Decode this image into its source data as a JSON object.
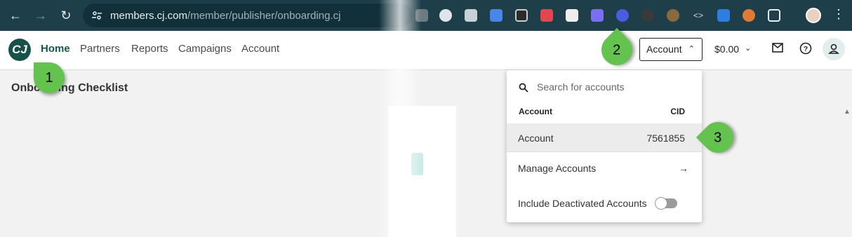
{
  "browser": {
    "url_host": "members.cj.com",
    "url_path": "/member/publisher/onboarding.cj",
    "extensions": [
      "bookmark-ext",
      "pinwheel-ext",
      "text-ext",
      "translate-ext",
      "layers-ext",
      "red-ext",
      "pen-ext",
      "gear-ext",
      "glasses-ext",
      "fire-ext",
      "face-ext",
      "code-ext",
      "tag-ext",
      "cookie-ext"
    ],
    "colors": {
      "chrome": "#1e3f4a",
      "omnibox": "#12303a"
    }
  },
  "header": {
    "logo_text": "CJ",
    "nav": [
      {
        "label": "Home",
        "active": true
      },
      {
        "label": "Partners",
        "active": false
      },
      {
        "label": "Reports",
        "active": false
      },
      {
        "label": "Campaigns",
        "active": false
      },
      {
        "label": "Account",
        "active": false
      }
    ],
    "account_button": "Account",
    "balance": "$0.00"
  },
  "page": {
    "title": "Onboarding Checklist"
  },
  "dropdown": {
    "search_placeholder": "Search for accounts",
    "col_account": "Account",
    "col_cid": "CID",
    "account_name": "Account",
    "account_cid": "7561855",
    "manage": "Manage Accounts",
    "include_deactivated": "Include Deactivated Accounts",
    "include_deactivated_on": false
  },
  "callouts": [
    "1",
    "2",
    "3"
  ],
  "colors": {
    "accent": "#17554f",
    "callout": "#64c24e"
  }
}
